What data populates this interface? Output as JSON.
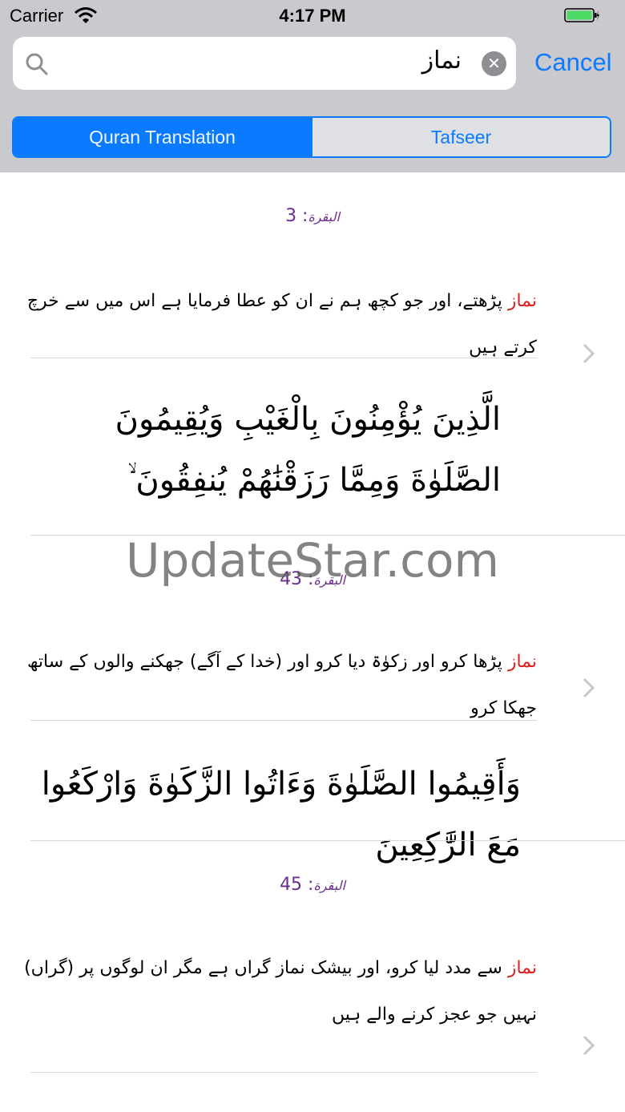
{
  "status_bar": {
    "carrier": "Carrier",
    "time": "4:17 PM"
  },
  "search": {
    "query": "نماز",
    "cancel_label": "Cancel"
  },
  "segments": {
    "quran_translation": "Quran Translation",
    "tafseer": "Tafseer"
  },
  "results": [
    {
      "surah": "البقرة",
      "ref": ": 3",
      "highlight": "نماز",
      "translation": "پڑھتے، اور جو کچھ ہم نے ان کو عطا فرمایا ہے اس میں سے خرچ کرتے ہیں",
      "arabic": "الَّذِينَ يُؤْمِنُونَ بِالْغَيْبِ وَيُقِيمُونَ الصَّلَوٰةَ وَمِمَّا رَزَقْنَٰهُمْ يُنفِقُونَ ۙ"
    },
    {
      "surah": "البقرة",
      "ref": ": 43",
      "highlight": "نماز",
      "translation": "پڑھا کرو اور زکوٰۃ دیا کرو اور (خدا کے آگے) جھکنے والوں کے ساتھ جھکا کرو",
      "arabic": "وَأَقِيمُوا الصَّلَوٰةَ وَءَاتُوا الزَّكَوٰةَ وَارْكَعُوا مَعَ الرَّٰكِعِينَ"
    },
    {
      "surah": "البقرة",
      "ref": ": 45",
      "highlight": "نماز",
      "translation": "سے مدد لیا کرو، اور بیشک نماز گراں ہے مگر ان لوگوں پر (گراں) نہیں جو عجز کرنے والے ہیں"
    }
  ],
  "watermark": "UpdateStar.com"
}
